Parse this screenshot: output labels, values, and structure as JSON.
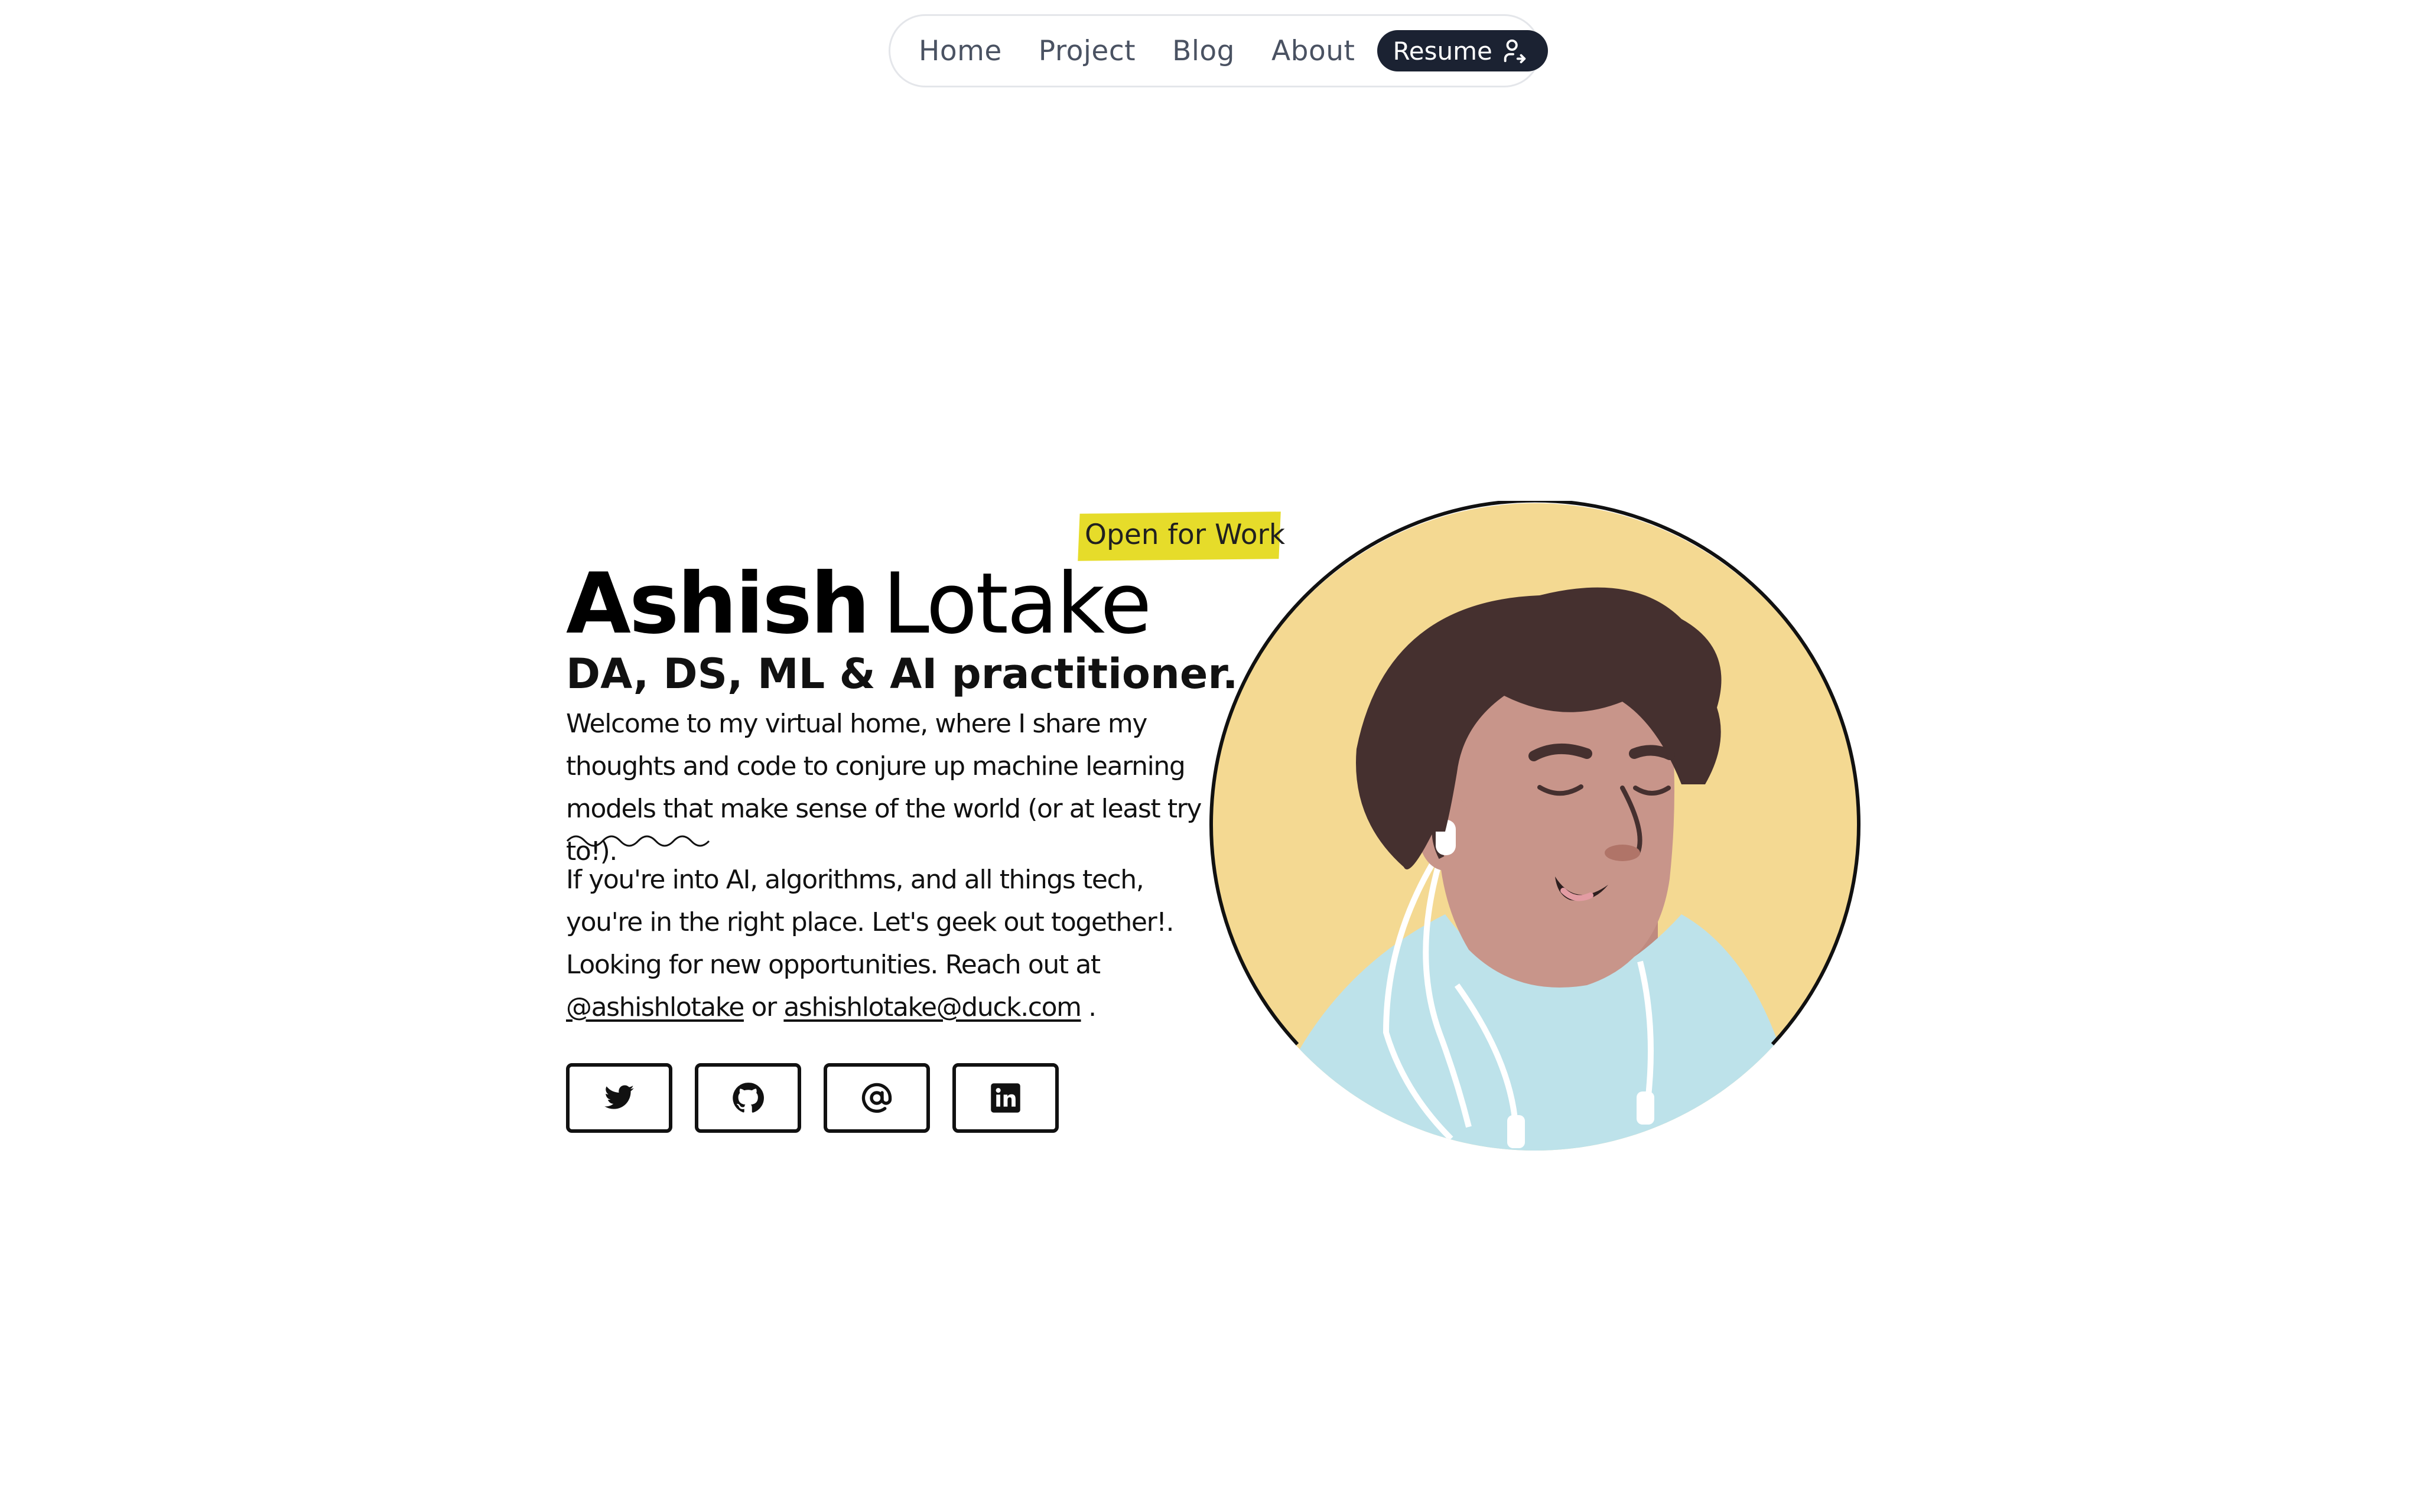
{
  "nav": {
    "items": [
      {
        "label": "Home"
      },
      {
        "label": "Project"
      },
      {
        "label": "Blog"
      },
      {
        "label": "About"
      }
    ],
    "resume_label": "Resume",
    "resume_icon": "user-arrow-icon"
  },
  "hero": {
    "badge": "Open for Work",
    "first_name": "Ashish",
    "last_name": "Lotake",
    "tagline": "DA, DS, ML & AI practitioner.",
    "intro": "Welcome to my virtual home, where I share my thoughts and code to conjure up machine learning models that make sense of the world (or at least try to!).",
    "pitch": "If you're into AI, algorithms, and all things tech, you're in the right place. Let's geek out together!. Looking for new opportunities. Reach out at",
    "twitter_handle": "@ashishlotake",
    "connector": "or",
    "email": "ashishlotake@duck.com",
    "end": "."
  },
  "socials": [
    {
      "icon": "twitter-icon"
    },
    {
      "icon": "github-icon"
    },
    {
      "icon": "at-sign-icon"
    },
    {
      "icon": "linkedin-icon"
    }
  ],
  "colors": {
    "nav_border": "#e4e6ea",
    "nav_text": "#4a5262",
    "resume_bg": "#1b2232",
    "badge_highlight": "#e6dc2a",
    "avatar_bg": "#f4d992",
    "hair": "#45302f",
    "skin": "#c8958a",
    "hoodie": "#bde2ea"
  }
}
